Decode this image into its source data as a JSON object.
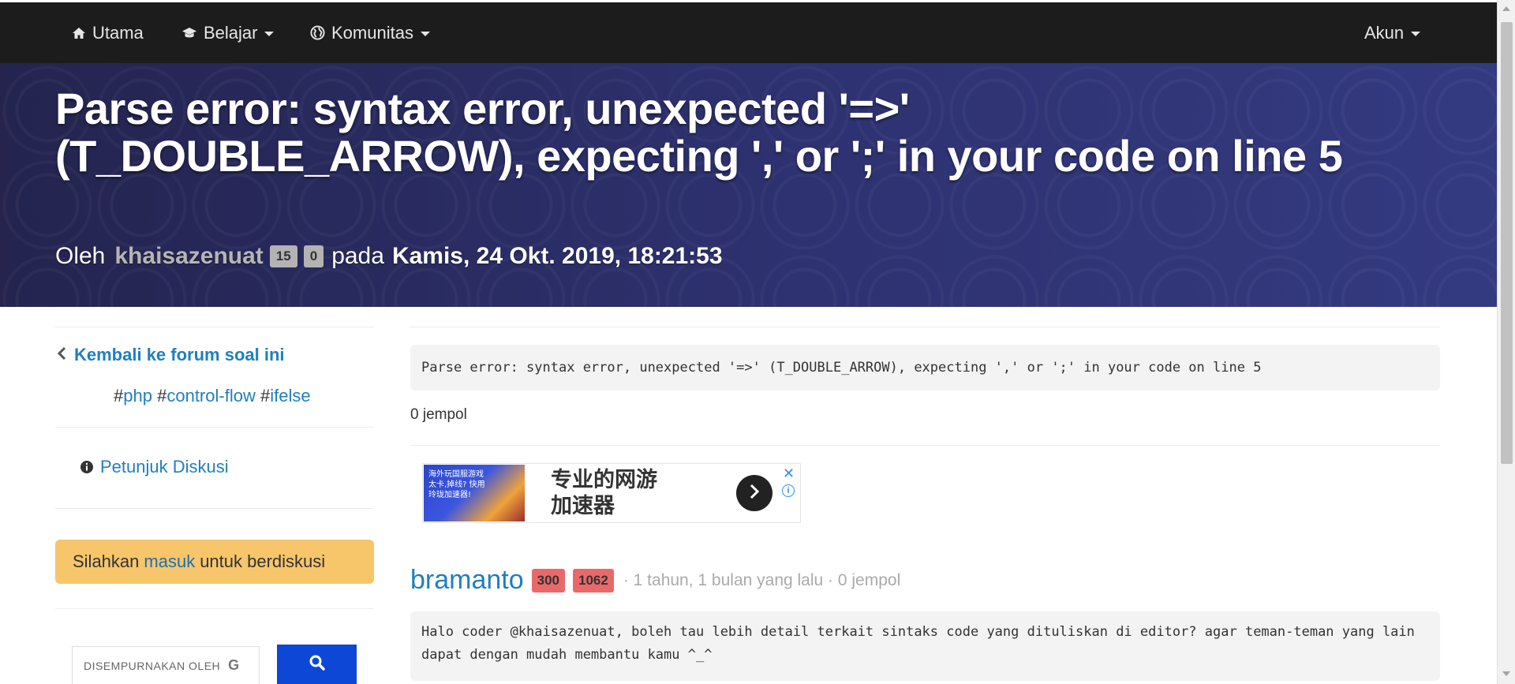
{
  "nav": {
    "home": {
      "label": "Utama",
      "icon": "home-icon"
    },
    "learn": {
      "label": "Belajar",
      "icon": "graduation-cap-icon"
    },
    "community": {
      "label": "Komunitas",
      "icon": "globe-icon"
    },
    "account": {
      "label": "Akun"
    }
  },
  "question": {
    "title": "Parse error: syntax error, unexpected '=>' (T_DOUBLE_ARROW), expecting ',' or ';' in your code on line 5",
    "by_label": "Oleh",
    "author": "khaisazenuat",
    "badge_1": "15",
    "badge_2": "0",
    "on_label": "pada",
    "date": "Kamis, 24 Okt. 2019, 18:21:53",
    "body": "Parse error: syntax error, unexpected '=>' (T_DOUBLE_ARROW), expecting ',' or ';' in your code on line 5",
    "likes": "0 jempol"
  },
  "sidebar": {
    "back_label": "Kembali ke forum soal ini",
    "tags": [
      {
        "hash": "#",
        "name": "php"
      },
      {
        "hash": "#",
        "name": "control-flow"
      },
      {
        "hash": "#",
        "name": "ifelse"
      }
    ],
    "guide_label": "Petunjuk Diskusi",
    "login": {
      "before": "Silahkan",
      "link": "masuk",
      "after": "untuk berdiskusi"
    },
    "search": {
      "enhanced": "DISEMPURNAKAN OLEH",
      "g": "G"
    }
  },
  "ad": {
    "image_text": "海外玩国服游戏 太卡,掉线? 快用玲珑加速器!",
    "line1": "专业的网游",
    "line2": "加速器"
  },
  "reply": {
    "author": "bramanto",
    "badge_1": "300",
    "badge_2": "1062",
    "meta": "· 1 tahun, 1 bulan yang lalu · 0 jempol",
    "body": "Halo coder @khaisazenuat, boleh tau lebih detail terkait sintaks code yang dituliskan di editor? agar teman-teman yang lain dapat dengan mudah membantu kamu ^_^"
  },
  "colors": {
    "navbar": "#1c1c1c",
    "hero": "#2e3271",
    "link": "#1f7fbf",
    "login_box": "#f7c56a",
    "red_badge": "#e9696a",
    "search_button": "#0d47d6"
  }
}
